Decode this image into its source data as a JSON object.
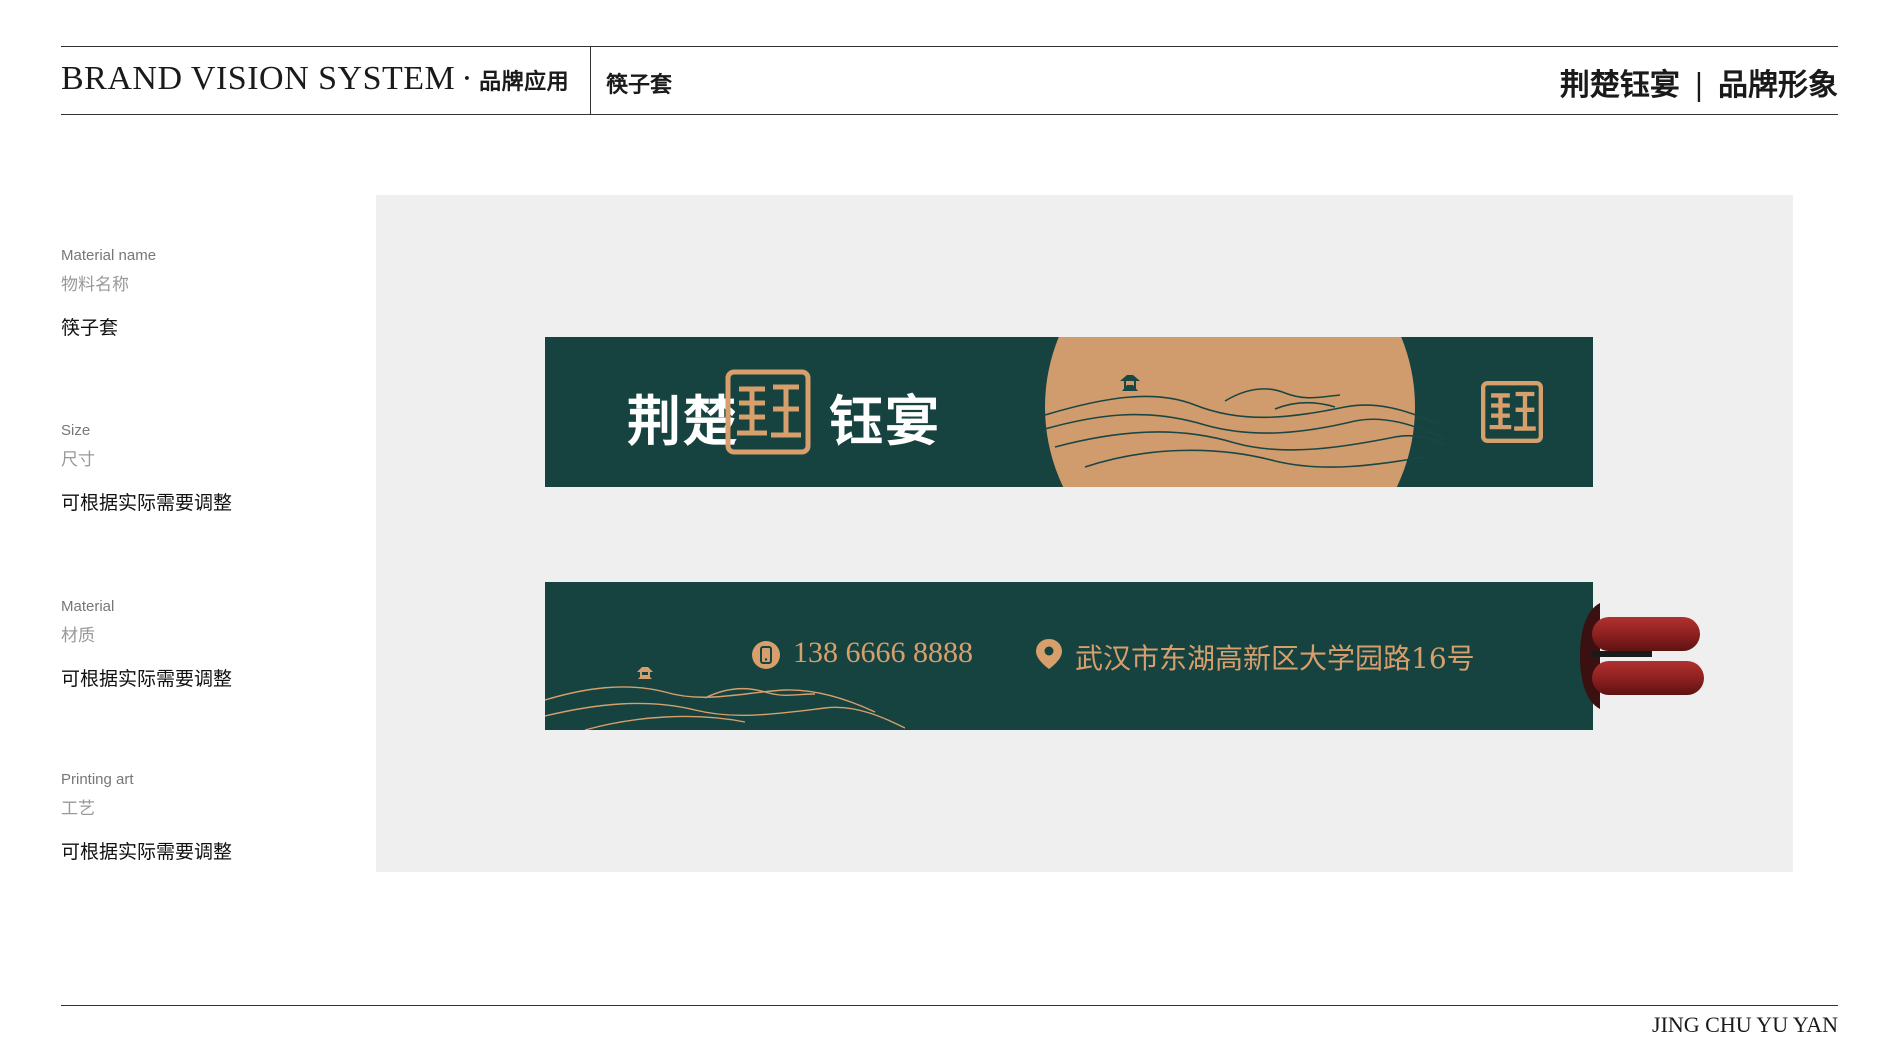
{
  "header": {
    "title": "BRAND VISION SYSTEM",
    "dot": "·",
    "category": "品牌应用",
    "section": "筷子套",
    "brand": "荆楚钰宴",
    "separator": "|",
    "brand_sub": "品牌形象"
  },
  "specs": [
    {
      "label_en": "Material name",
      "label_cn": "物料名称",
      "value": "筷子套"
    },
    {
      "label_en": "Size",
      "label_cn": "尺寸",
      "value": "可根据实际需要调整"
    },
    {
      "label_en": "Material",
      "label_cn": "材质",
      "value": "可根据实际需要调整"
    },
    {
      "label_en": "Printing art",
      "label_cn": "工艺",
      "value": "可根据实际需要调整"
    }
  ],
  "sleeve_front": {
    "logo_left": "荆楚",
    "logo_right": "钰宴"
  },
  "sleeve_back": {
    "phone": "138 6666 8888",
    "address": "武汉市东湖高新区大学园路16号"
  },
  "footer": {
    "text": "JING CHU YU YAN"
  },
  "icons": {
    "seal": "yu-seal-icon",
    "phone": "phone-icon",
    "location": "location-pin-icon",
    "pavilion": "pavilion-icon"
  },
  "colors": {
    "sleeve_green": "#164340",
    "gold": "#d69f6c",
    "sun": "#d19c6d",
    "chopstick_red": "#8a1f1f",
    "panel": "#efefef"
  }
}
